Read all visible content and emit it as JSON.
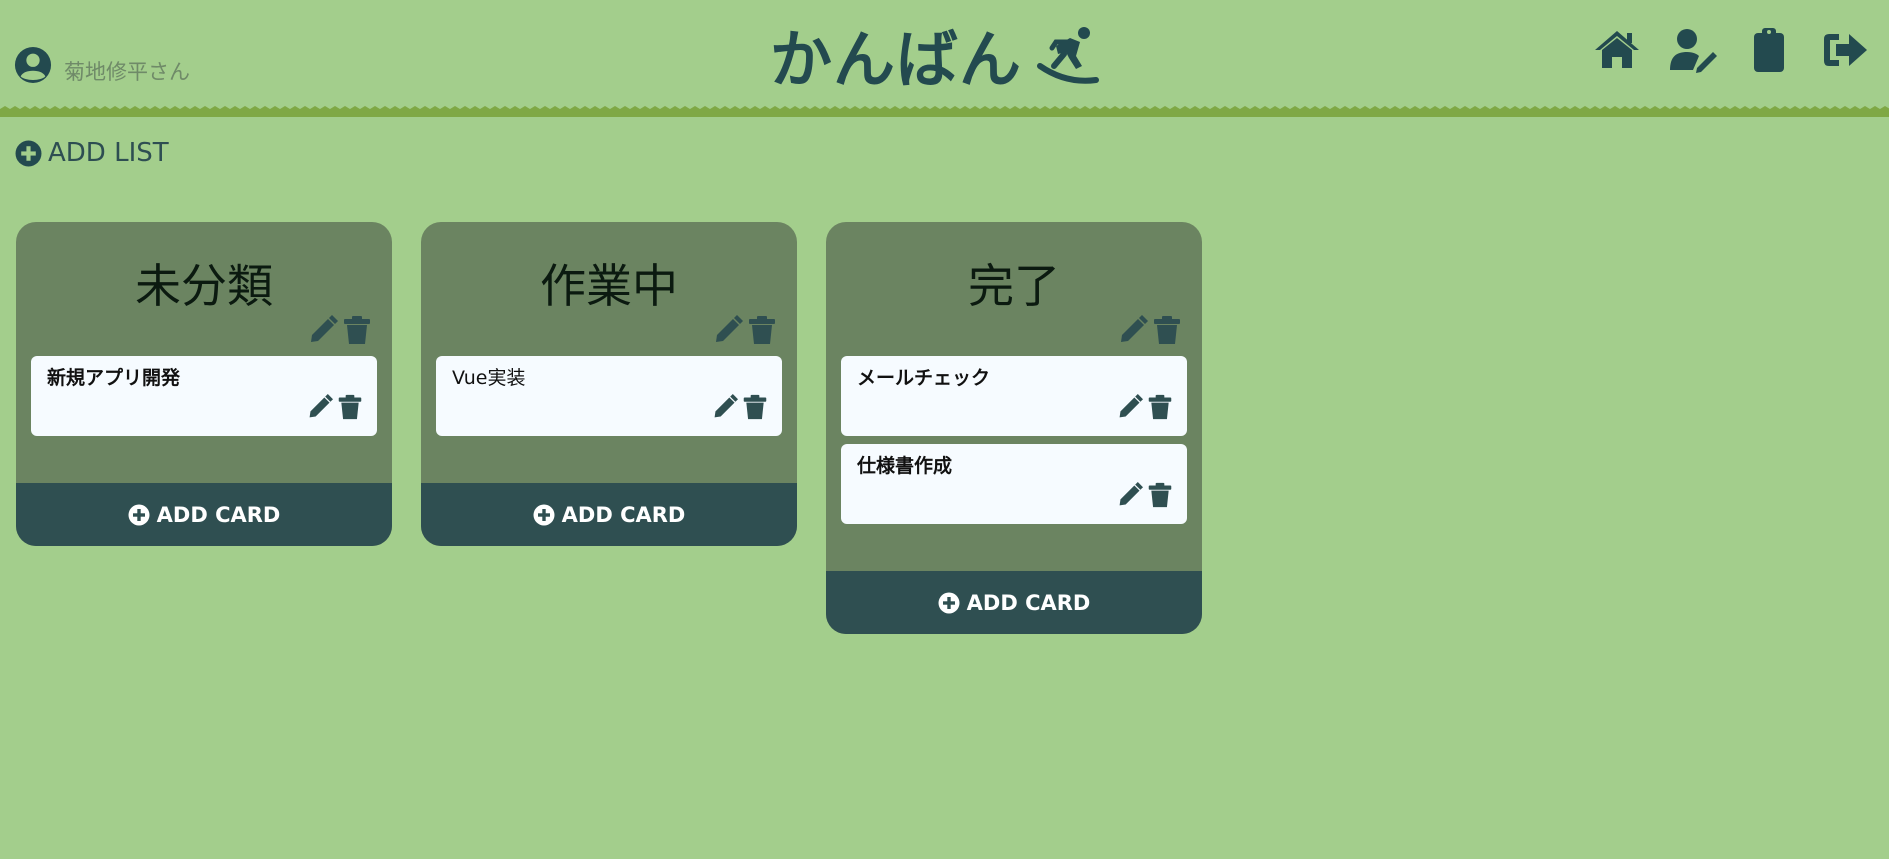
{
  "colors": {
    "background": "#a3ce8c",
    "primary_dark": "#234a4f",
    "list_bg": "#6b8461",
    "card_bg": "#f6fbff",
    "add_card_bg": "#2f4f51",
    "zigzag": "#7fa845"
  },
  "header": {
    "user_name": "菊地修平さん",
    "user_icon": "user-circle-icon",
    "logo_text": "かんばん",
    "logo_icon": "snowboarder-icon",
    "nav": [
      {
        "icon": "home-icon"
      },
      {
        "icon": "user-edit-icon"
      },
      {
        "icon": "clipboard-icon"
      },
      {
        "icon": "sign-out-icon"
      }
    ]
  },
  "toolbar": {
    "add_list_label": "ADD LIST"
  },
  "lists": [
    {
      "title": "未分類",
      "cards": [
        {
          "title": "新規アプリ開発"
        }
      ],
      "add_card_label": "ADD CARD"
    },
    {
      "title": "作業中",
      "cards": [
        {
          "title": "Vue実装"
        }
      ],
      "add_card_label": "ADD CARD"
    },
    {
      "title": "完了",
      "cards": [
        {
          "title": "メールチェック"
        },
        {
          "title": "仕様書作成"
        }
      ],
      "add_card_label": "ADD CARD"
    }
  ]
}
